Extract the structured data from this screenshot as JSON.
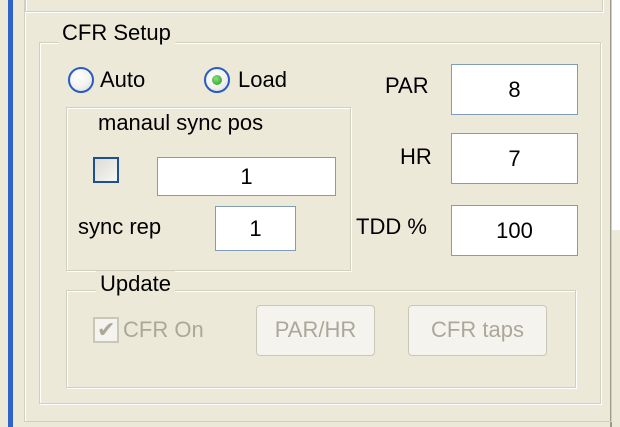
{
  "cfr_setup": {
    "title": "CFR Setup",
    "mode_options": [
      {
        "label": "Auto",
        "selected": false
      },
      {
        "label": "Load",
        "selected": true
      }
    ],
    "par": {
      "label": "PAR",
      "value": "8"
    },
    "hr": {
      "label": "HR",
      "value": "7"
    },
    "tdd": {
      "label": "TDD %",
      "value": "100"
    },
    "manual_sync": {
      "title": "manaul sync pos",
      "enabled": false,
      "position_value": "1",
      "rep_label": "sync rep",
      "rep_value": "1"
    },
    "update": {
      "title": "Update",
      "cfr_on_label": "CFR On",
      "cfr_on_checked": true,
      "cfr_on_check_glyph": "✔",
      "par_hr_button": "PAR/HR",
      "cfr_taps_button": "CFR taps"
    }
  }
}
